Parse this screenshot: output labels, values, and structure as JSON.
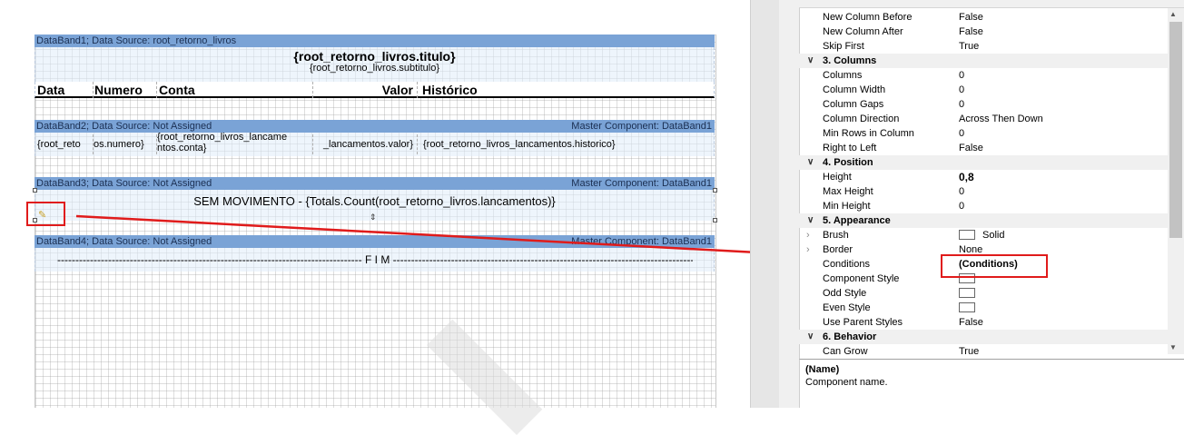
{
  "report": {
    "band1": {
      "header": "DataBand1; Data Source: root_retorno_livros",
      "title": "{root_retorno_livros.titulo}",
      "subtitle": "{root_retorno_livros.subtitulo}",
      "columns": [
        "Data",
        "Numero",
        "Conta",
        "Valor",
        "Histórico"
      ]
    },
    "band2": {
      "header": "DataBand2; Data Source: Not Assigned",
      "master": "Master Component: DataBand1",
      "cells": [
        "{root_reto",
        "os.numero}",
        "{root_retorno_livros_lancame",
        "ntos.conta}",
        "_lancamentos.valor}",
        "{root_retorno_livros_lancamentos.historico}"
      ]
    },
    "band3": {
      "header": "DataBand3; Data Source: Not Assigned",
      "master": "Master Component: DataBand1",
      "text": "SEM MOVIMENTO - {Totals.Count(root_retorno_livros.lancamentos)}"
    },
    "band4": {
      "header": "DataBand4; Data Source: Not Assigned",
      "master": "Master Component: DataBand1",
      "text": "------------------------------------------------------------------------------------ F I M -----------------------------------------------------------------------------------"
    }
  },
  "properties": {
    "rows": [
      {
        "type": "prop",
        "name": "New Column Before",
        "value": "False"
      },
      {
        "type": "prop",
        "name": "New Column After",
        "value": "False"
      },
      {
        "type": "prop",
        "name": "Skip First",
        "value": "True"
      },
      {
        "type": "cat",
        "name": "3. Columns"
      },
      {
        "type": "prop",
        "name": "Columns",
        "value": "0"
      },
      {
        "type": "prop",
        "name": "Column Width",
        "value": "0"
      },
      {
        "type": "prop",
        "name": "Column Gaps",
        "value": "0"
      },
      {
        "type": "prop",
        "name": "Column Direction",
        "value": "Across Then Down"
      },
      {
        "type": "prop",
        "name": "Min Rows in Column",
        "value": "0"
      },
      {
        "type": "prop",
        "name": "Right to Left",
        "value": "False"
      },
      {
        "type": "cat",
        "name": "4. Position"
      },
      {
        "type": "prop",
        "name": "Height",
        "value": "0,8",
        "bold": true
      },
      {
        "type": "prop",
        "name": "Max Height",
        "value": "0"
      },
      {
        "type": "prop",
        "name": "Min Height",
        "value": "0"
      },
      {
        "type": "cat",
        "name": "5. Appearance"
      },
      {
        "type": "prop",
        "name": "Brush",
        "value": "Solid",
        "expand": true,
        "swatch": true
      },
      {
        "type": "prop",
        "name": "Border",
        "value": "None",
        "expand": true
      },
      {
        "type": "prop",
        "name": "Conditions",
        "value": "(Conditions)",
        "bold": true
      },
      {
        "type": "prop",
        "name": "Component Style",
        "value": "",
        "swatch": true
      },
      {
        "type": "prop",
        "name": "Odd Style",
        "value": "",
        "swatch": true
      },
      {
        "type": "prop",
        "name": "Even Style",
        "value": "",
        "swatch": true
      },
      {
        "type": "prop",
        "name": "Use Parent Styles",
        "value": "False"
      },
      {
        "type": "cat",
        "name": "6. Behavior"
      },
      {
        "type": "prop",
        "name": "Can Grow",
        "value": "True"
      }
    ],
    "description": {
      "title": "(Name)",
      "text": "Component name."
    }
  },
  "colors": {
    "band_header": "#7aa3d6",
    "annotation": "#e01b1b"
  }
}
